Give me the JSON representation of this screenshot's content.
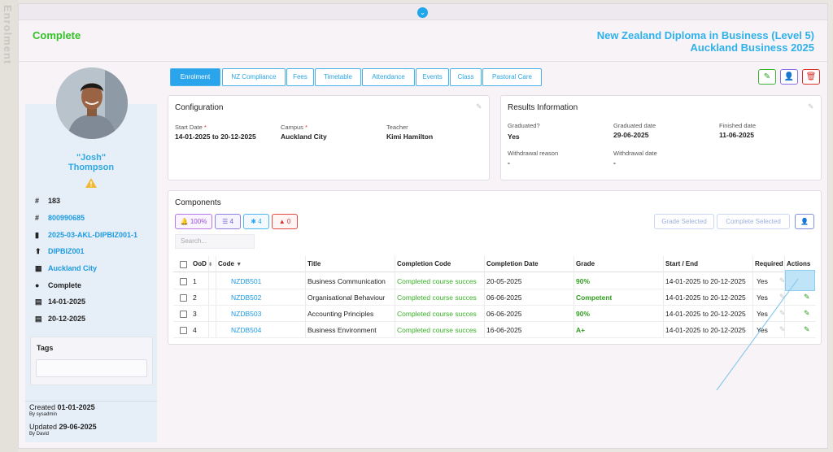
{
  "side_tab": "Enrolment",
  "status": "Complete",
  "program": {
    "title": "New Zealand Diploma in Business (Level 5)",
    "provider": "Auckland Business 2025"
  },
  "student": {
    "nickname": "\"Josh\"",
    "surname": "Thompson",
    "info": [
      {
        "icon": "hash-icon",
        "glyph": "#",
        "value": "183",
        "link": false
      },
      {
        "icon": "hash-icon",
        "glyph": "#",
        "value": "800990685",
        "link": true
      },
      {
        "icon": "book-icon",
        "glyph": "▮",
        "value": "2025-03-AKL-DIPBIZ001-1",
        "link": true
      },
      {
        "icon": "signpost-icon",
        "glyph": "⬆",
        "value": "DIPBIZ001",
        "link": true
      },
      {
        "icon": "building-icon",
        "glyph": "▦",
        "value": "Auckland City",
        "link": true
      },
      {
        "icon": "question-circle-icon",
        "glyph": "●",
        "value": "Complete",
        "link": false
      },
      {
        "icon": "calendar-icon",
        "glyph": "▤",
        "value": "14-01-2025",
        "link": false
      },
      {
        "icon": "calendar-icon",
        "glyph": "▤",
        "value": "20-12-2025",
        "link": false
      }
    ],
    "tags_label": "Tags",
    "created_label": "Created",
    "created_date": "01-01-2025",
    "created_by": "By sysadmin",
    "updated_label": "Updated",
    "updated_date": "29-06-2025",
    "updated_by": "By David"
  },
  "tabs": [
    "Enrolment",
    "NZ Compliance",
    "Fees",
    "Timetable",
    "Attendance",
    "Events",
    "Class",
    "Pastoral Care"
  ],
  "configuration": {
    "title": "Configuration",
    "start_label": "Start Date",
    "start_value": "14-01-2025 to 20-12-2025",
    "campus_label": "Campus",
    "campus_value": "Auckland City",
    "teacher_label": "Teacher",
    "teacher_value": "Kimi Hamilton"
  },
  "results": {
    "title": "Results Information",
    "graduated_label": "Graduated?",
    "graduated_value": "Yes",
    "graduated_date_label": "Graduated date",
    "graduated_date_value": "29-06-2025",
    "finished_label": "Finished date",
    "finished_value": "11-06-2025",
    "withdrawal_reason_label": "Withdrawal reason",
    "withdrawal_reason_value": "-",
    "withdrawal_date_label": "Withdrawal date",
    "withdrawal_date_value": "-"
  },
  "components": {
    "title": "Components",
    "chips": [
      "100%",
      "4",
      "4",
      "0"
    ],
    "grade_selected": "Grade Selected",
    "complete_selected": "Complete Selected",
    "search_placeholder": "Search...",
    "columns": [
      "OoD",
      "Code",
      "Title",
      "Completion Code",
      "Completion Date",
      "Grade",
      "Start / End",
      "Required",
      "Actions"
    ],
    "rows": [
      {
        "ood": "1",
        "code": "NZDB501",
        "title": "Business Communication",
        "ccode": "Completed course succes",
        "cdate": "20-05-2025",
        "grade": "90%",
        "range": "14-01-2025 to 20-12-2025",
        "req": "Yes"
      },
      {
        "ood": "2",
        "code": "NZDB502",
        "title": "Organisational Behaviour",
        "ccode": "Completed course succes",
        "cdate": "06-06-2025",
        "grade": "Competent",
        "range": "14-01-2025 to 20-12-2025",
        "req": "Yes"
      },
      {
        "ood": "3",
        "code": "NZDB503",
        "title": "Accounting Principles",
        "ccode": "Completed course succes",
        "cdate": "06-06-2025",
        "grade": "90%",
        "range": "14-01-2025 to 20-12-2025",
        "req": "Yes"
      },
      {
        "ood": "4",
        "code": "NZDB504",
        "title": "Business Environment",
        "ccode": "Completed course succes",
        "cdate": "16-06-2025",
        "grade": "A+",
        "range": "14-01-2025 to 20-12-2025",
        "req": "Yes"
      }
    ]
  },
  "colors": {
    "accent": "#2aa4ea",
    "success": "#39b127",
    "danger": "#d9302a",
    "purple": "#8a6be8"
  }
}
